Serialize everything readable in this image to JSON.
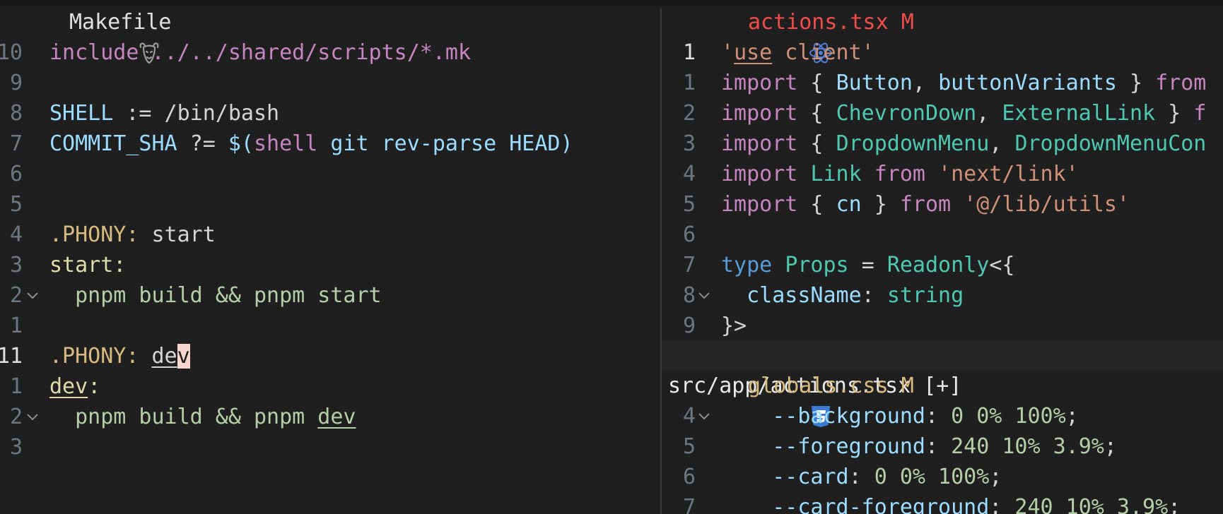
{
  "colors": {
    "background": "#1f1f1f",
    "keyword": "#c586c0",
    "string": "#ce9178",
    "variable": "#9cdcfe",
    "plain": "#d4d4d4",
    "type": "#4ec9b0",
    "function": "#dcdcaa",
    "number": "#b5cea8",
    "command": "#d7ba7d",
    "tab_modified": "#f14c4c",
    "line_number": "#6e7681"
  },
  "left_pane": {
    "tab": {
      "icon": "gnu-icon",
      "label": "Makefile"
    },
    "lines": [
      {
        "ln": "10",
        "tokens": [
          {
            "t": "include ../../shared/scripts/*.mk",
            "c": "#c586c0"
          }
        ]
      },
      {
        "ln": "9",
        "tokens": []
      },
      {
        "ln": "8",
        "tokens": [
          {
            "t": "SHELL",
            "c": "#9cdcfe"
          },
          {
            "t": " := /bin/bash",
            "c": "#d4d4d4"
          }
        ]
      },
      {
        "ln": "7",
        "tokens": [
          {
            "t": "COMMIT_SHA",
            "c": "#9cdcfe"
          },
          {
            "t": " ?= ",
            "c": "#d4d4d4"
          },
          {
            "t": "$(",
            "c": "#9cdcfe"
          },
          {
            "t": "shell",
            "c": "#c586c0"
          },
          {
            "t": " git rev-parse HEAD)",
            "c": "#9cdcfe"
          }
        ]
      },
      {
        "ln": "6",
        "tokens": []
      },
      {
        "ln": "5",
        "tokens": []
      },
      {
        "ln": "4",
        "tokens": [
          {
            "t": ".PHONY:",
            "c": "#d7ba7d"
          },
          {
            "t": " start",
            "c": "#d4d4d4"
          }
        ]
      },
      {
        "ln": "3",
        "tokens": [
          {
            "t": "start:",
            "c": "#dcdcaa"
          }
        ]
      },
      {
        "ln": "2",
        "fold": true,
        "tokens": [
          {
            "t": "  pnpm build && pnpm start",
            "c": "#b5cea8"
          }
        ]
      },
      {
        "ln": "1",
        "tokens": []
      },
      {
        "ln": "11",
        "current": true,
        "tokens": [
          {
            "t": ".PHONY:",
            "c": "#d7ba7d"
          },
          {
            "t": " ",
            "c": "#d4d4d4"
          },
          {
            "t": "de",
            "c": "#d4d4d4",
            "u": true
          },
          {
            "t": "v",
            "c": "#1f1f1f",
            "cursor": true
          }
        ]
      },
      {
        "ln": "1",
        "tokens": [
          {
            "t": "dev",
            "c": "#dcdcaa",
            "u": true
          },
          {
            "t": ":",
            "c": "#dcdcaa"
          }
        ]
      },
      {
        "ln": "2",
        "fold": true,
        "tokens": [
          {
            "t": "  pnpm build && pnpm ",
            "c": "#b5cea8"
          },
          {
            "t": "dev",
            "c": "#b5cea8",
            "u": true
          }
        ]
      },
      {
        "ln": "3",
        "tokens": []
      }
    ]
  },
  "right_pane": {
    "tab_top": {
      "icon": "react-icon",
      "label": "actions.tsx M"
    },
    "lines_top": [
      {
        "ln": "1",
        "current": true,
        "tokens": [
          {
            "t": "'",
            "c": "#ce9178"
          },
          {
            "t": "use",
            "c": "#ce9178",
            "u": true
          },
          {
            "t": " client'",
            "c": "#ce9178"
          }
        ]
      },
      {
        "ln": "1",
        "tokens": [
          {
            "t": "import",
            "c": "#c586c0"
          },
          {
            "t": " { ",
            "c": "#d4d4d4"
          },
          {
            "t": "Button",
            "c": "#9cdcfe"
          },
          {
            "t": ", ",
            "c": "#d4d4d4"
          },
          {
            "t": "buttonVariants",
            "c": "#9cdcfe"
          },
          {
            "t": " } ",
            "c": "#d4d4d4"
          },
          {
            "t": "from",
            "c": "#c586c0"
          }
        ]
      },
      {
        "ln": "2",
        "tokens": [
          {
            "t": "import",
            "c": "#c586c0"
          },
          {
            "t": " { ",
            "c": "#d4d4d4"
          },
          {
            "t": "ChevronDown",
            "c": "#4ec9b0"
          },
          {
            "t": ", ",
            "c": "#d4d4d4"
          },
          {
            "t": "ExternalLink",
            "c": "#4ec9b0"
          },
          {
            "t": " } ",
            "c": "#d4d4d4"
          },
          {
            "t": "f",
            "c": "#c586c0"
          }
        ]
      },
      {
        "ln": "3",
        "tokens": [
          {
            "t": "import",
            "c": "#c586c0"
          },
          {
            "t": " { ",
            "c": "#d4d4d4"
          },
          {
            "t": "DropdownMenu",
            "c": "#4ec9b0"
          },
          {
            "t": ", ",
            "c": "#d4d4d4"
          },
          {
            "t": "DropdownMenuCon",
            "c": "#4ec9b0"
          }
        ]
      },
      {
        "ln": "4",
        "tokens": [
          {
            "t": "import",
            "c": "#c586c0"
          },
          {
            "t": " ",
            "c": "#d4d4d4"
          },
          {
            "t": "Link",
            "c": "#4ec9b0"
          },
          {
            "t": " ",
            "c": "#d4d4d4"
          },
          {
            "t": "from",
            "c": "#c586c0"
          },
          {
            "t": " 'next/link'",
            "c": "#ce9178"
          }
        ]
      },
      {
        "ln": "5",
        "tokens": [
          {
            "t": "import",
            "c": "#c586c0"
          },
          {
            "t": " { ",
            "c": "#d4d4d4"
          },
          {
            "t": "cn",
            "c": "#9cdcfe"
          },
          {
            "t": " } ",
            "c": "#d4d4d4"
          },
          {
            "t": "from",
            "c": "#c586c0"
          },
          {
            "t": " '@/lib/utils'",
            "c": "#ce9178"
          }
        ]
      },
      {
        "ln": "6",
        "tokens": []
      },
      {
        "ln": "7",
        "tokens": [
          {
            "t": "type",
            "c": "#569cd6"
          },
          {
            "t": " ",
            "c": "#d4d4d4"
          },
          {
            "t": "Props",
            "c": "#4ec9b0"
          },
          {
            "t": " = ",
            "c": "#d4d4d4"
          },
          {
            "t": "Readonly",
            "c": "#4ec9b0"
          },
          {
            "t": "<{",
            "c": "#d4d4d4"
          }
        ]
      },
      {
        "ln": "8",
        "fold": true,
        "tokens": [
          {
            "t": "  ",
            "c": "#d4d4d4"
          },
          {
            "t": "className",
            "c": "#9cdcfe"
          },
          {
            "t": ": ",
            "c": "#d4d4d4"
          },
          {
            "t": "string",
            "c": "#4ec9b0"
          }
        ]
      },
      {
        "ln": "9",
        "tokens": [
          {
            "t": "}>",
            "c": "#d4d4d4"
          }
        ]
      }
    ],
    "statusline": "src/app/actions.tsx [+]",
    "tab_bottom": {
      "icon": "css3-icon",
      "label": "globals.css M"
    },
    "lines_bottom": [
      {
        "ln": "4",
        "fold": true,
        "tokens": [
          {
            "t": "    --background",
            "c": "#9cdcfe"
          },
          {
            "t": ": ",
            "c": "#d4d4d4"
          },
          {
            "t": "0 0% 100%",
            "c": "#b5cea8"
          },
          {
            "t": ";",
            "c": "#d4d4d4"
          }
        ]
      },
      {
        "ln": "5",
        "tokens": [
          {
            "t": "    --foreground",
            "c": "#9cdcfe"
          },
          {
            "t": ": ",
            "c": "#d4d4d4"
          },
          {
            "t": "240 10% 3.9%",
            "c": "#b5cea8"
          },
          {
            "t": ";",
            "c": "#d4d4d4"
          }
        ]
      },
      {
        "ln": "6",
        "tokens": [
          {
            "t": "    --card",
            "c": "#9cdcfe"
          },
          {
            "t": ": ",
            "c": "#d4d4d4"
          },
          {
            "t": "0 0% 100%",
            "c": "#b5cea8"
          },
          {
            "t": ";",
            "c": "#d4d4d4"
          }
        ]
      },
      {
        "ln": "7",
        "tokens": [
          {
            "t": "    --card-foreground",
            "c": "#9cdcfe"
          },
          {
            "t": ": ",
            "c": "#d4d4d4"
          },
          {
            "t": "240 10% 3.9%",
            "c": "#b5cea8"
          },
          {
            "t": ";",
            "c": "#d4d4d4"
          }
        ]
      }
    ]
  }
}
